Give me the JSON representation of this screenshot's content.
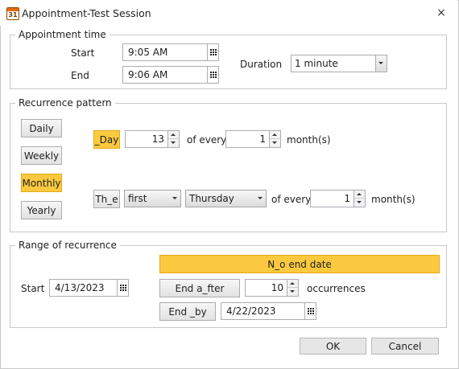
{
  "window": {
    "title": "Appointment-Test Session",
    "icon_text": "31",
    "icon": "calendar-app-icon",
    "close_glyph": "×"
  },
  "appointment_time": {
    "legend": "Appointment time",
    "start_label": "Start",
    "start_value": "9:05 AM",
    "end_label": "End",
    "end_value": "9:06 AM",
    "duration_label": "Duration",
    "duration_value": "1 minute"
  },
  "recurrence_pattern": {
    "legend": "Recurrence pattern",
    "types": [
      "Daily",
      "Weekly",
      "Monthly",
      "Yearly"
    ],
    "selected_type": "Monthly",
    "day_option": {
      "label": "_Day",
      "day_value": "13",
      "of_every_label": "of every",
      "months_value": "1",
      "months_label": "month(s)"
    },
    "the_option": {
      "label": "Th_e",
      "ordinal_value": "first",
      "weekday_value": "Thursday",
      "of_every_label": "of every",
      "months_value": "1",
      "months_label": "month(s)"
    }
  },
  "range_of_recurrence": {
    "legend": "Range of recurrence",
    "start_label": "Start",
    "start_value": "4/13/2023",
    "no_end_label": "N_o end date",
    "end_after_label": "End a_fter",
    "occurrences_value": "10",
    "occurrences_label": "occurrences",
    "end_by_label": "End _by",
    "end_by_value": "4/22/2023"
  },
  "footer": {
    "ok_label": "OK",
    "cancel_label": "Cancel"
  },
  "colors": {
    "selected_accent": "#fbc93f",
    "window_background": "#ffffff",
    "border": "#c7c7c7"
  }
}
